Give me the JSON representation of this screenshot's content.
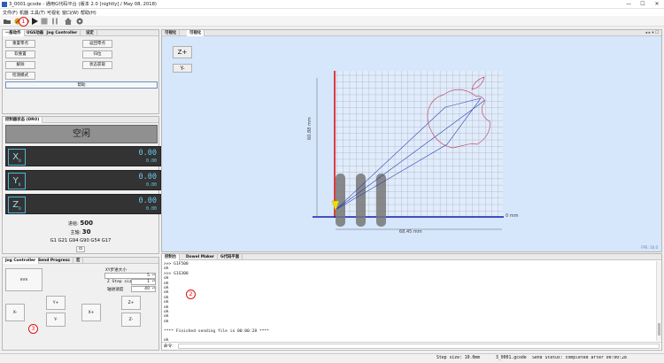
{
  "window": {
    "title": "3_0001.gcode - 通用G代码平台 (版本 2.0 [nightly] / May 08, 2018)",
    "controls": [
      "—",
      "☐",
      "✕"
    ]
  },
  "menu": [
    "文件(F)",
    "机器",
    "工具(T)",
    "可视化",
    "窗口(W)",
    "帮助(H)"
  ],
  "panels": {
    "left_top": {
      "tabs": [
        "一般动作",
        "UGS动画",
        "Jog Controller",
        "设定"
      ],
      "buttons": [
        "重置零点",
        "返回零点",
        "软重置",
        "归位",
        "解除",
        "状态获取",
        "检测模式"
      ],
      "help_label": "帮助"
    },
    "dro": {
      "tab": "控制器状态 (DRO)",
      "state_text": "空闲",
      "axes": [
        {
          "label": "X",
          "sub": "0",
          "value": "0.00",
          "work": "0.00"
        },
        {
          "label": "Y",
          "sub": "0",
          "value": "0.00",
          "work": "0.00"
        },
        {
          "label": "Z",
          "sub": "0",
          "value": "0.00",
          "work": "0.00"
        }
      ],
      "feed_label": "进给:",
      "feed_value": "500",
      "spindle_label": "主轴:",
      "spindle_value": "30",
      "gcode_state": "G1 G21 G94 G90 G54 G17",
      "mini_btn": "⊡"
    },
    "jog": {
      "tabs": [
        "Jog Controller",
        "Send Progress",
        "宏"
      ],
      "xy_step_label": "XY步进大小",
      "xy_step_value": "5",
      "z_step_label": "Z Step size:",
      "z_step_value": "1",
      "feed_label": "轴进速度",
      "feed_value": "40",
      "mm_label": "mm",
      "buttons": {
        "y_plus": "Y+",
        "y_minus": "Y-",
        "x_minus": "X-",
        "x_plus": "X+",
        "z_plus": "Z+",
        "z_minus": "Z-"
      }
    },
    "visualizer": {
      "tabs": [
        "可视化",
        "可视化"
      ],
      "nav_arrows": "◂ ▸ ▾ ☐",
      "z_plus": "Z+",
      "y_minus": "Y-",
      "width_label": "68.45 mm",
      "height_label": "60.88 mm",
      "zero_label": "0 mm",
      "fps": "FPS: 16.0"
    },
    "console": {
      "tabs": [
        "控制台",
        "Dowel Maker",
        "G代码平面"
      ],
      "lines": [
        ">>> G1F500",
        "ok",
        ">>> G1S300",
        "ok",
        "ok",
        "ok",
        "ok",
        "ok",
        "ok",
        "ok",
        "ok",
        "ok",
        "ok",
        "",
        "**** Finished sending file in 00:00:28 ****",
        "",
        "ok"
      ],
      "command_label": "命令:"
    }
  },
  "status": {
    "step_size": "Step size: 10.0mm",
    "file": "3_0001.gcode",
    "send_status": "Send Status: completed after 00:00:28"
  },
  "markers": [
    "1",
    "2",
    "3"
  ],
  "colors": {
    "accent": "#4fb6d6",
    "dro_bg": "#333333",
    "visualizer_bg": "#d6e6fb",
    "marker": "#dd1111"
  }
}
